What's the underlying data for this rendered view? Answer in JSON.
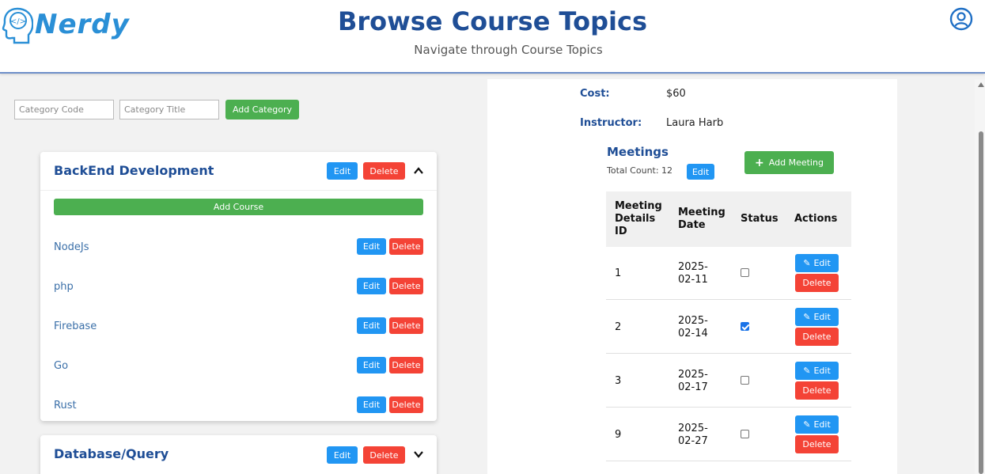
{
  "app": {
    "logo_text": "Nerdy",
    "title": "Browse Course Topics",
    "subtitle": "Navigate through Course Topics"
  },
  "icons": {
    "user": "user-circle-icon",
    "logo": "head-code-icon",
    "chevron_up": "chevron-up-icon",
    "chevron_down": "chevron-down-icon",
    "plus": "plus-icon",
    "pencil": "pencil-icon"
  },
  "colors": {
    "accent": "#1f4e96",
    "green": "#4caf50",
    "blue": "#2196f3",
    "red": "#f44336"
  },
  "category_form": {
    "code_placeholder": "Category Code",
    "title_placeholder": "Category Title",
    "add_label": "Add Category"
  },
  "categories": [
    {
      "title": "BackEnd Development",
      "edit_label": "Edit",
      "delete_label": "Delete",
      "add_course_label": "Add Course",
      "expanded": true,
      "courses": [
        {
          "name": "NodeJs",
          "edit_label": "Edit",
          "delete_label": "Delete"
        },
        {
          "name": "php",
          "edit_label": "Edit",
          "delete_label": "Delete"
        },
        {
          "name": "Firebase",
          "edit_label": "Edit",
          "delete_label": "Delete"
        },
        {
          "name": "Go",
          "edit_label": "Edit",
          "delete_label": "Delete"
        },
        {
          "name": "Rust",
          "edit_label": "Edit",
          "delete_label": "Delete"
        }
      ]
    },
    {
      "title": "Database/Query",
      "edit_label": "Edit",
      "delete_label": "Delete",
      "expanded": false
    }
  ],
  "course_details": {
    "cost_label": "Cost:",
    "cost_value": "$60",
    "instructor_label": "Instructor:",
    "instructor_value": "Laura Harb"
  },
  "meetings": {
    "title": "Meetings",
    "total_count_text": "Total Count: 12",
    "edit_label": "Edit",
    "add_label": "Add Meeting",
    "columns": {
      "id": [
        "Meeting",
        "Details",
        "ID"
      ],
      "date": [
        "Meeting",
        "Date"
      ],
      "status": "Status",
      "actions": "Actions"
    },
    "rows": [
      {
        "id": "1",
        "date_year": "2025-",
        "date_rest": "02-11",
        "checked": false,
        "edit_label": "Edit",
        "delete_label": "Delete"
      },
      {
        "id": "2",
        "date_year": "2025-",
        "date_rest": "02-14",
        "checked": true,
        "edit_label": "Edit",
        "delete_label": "Delete"
      },
      {
        "id": "3",
        "date_year": "2025-",
        "date_rest": "02-17",
        "checked": false,
        "edit_label": "Edit",
        "delete_label": "Delete"
      },
      {
        "id": "9",
        "date_year": "2025-",
        "date_rest": "02-27",
        "checked": false,
        "edit_label": "Edit",
        "delete_label": "Delete"
      }
    ]
  }
}
